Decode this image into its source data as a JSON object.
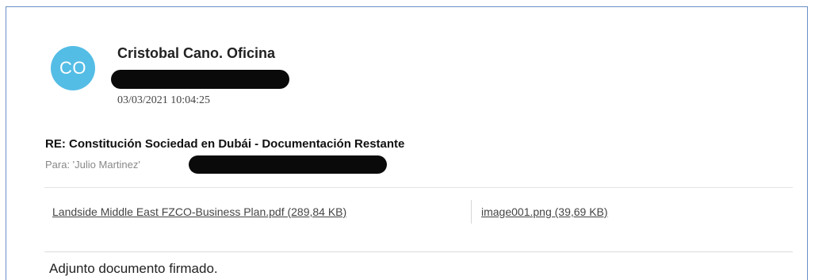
{
  "sender": {
    "avatar_initials": "CO",
    "avatar_color": "#54bde5",
    "name": "Cristobal Cano. Oficina",
    "timestamp": "03/03/2021 10:04:25"
  },
  "message": {
    "subject": "RE: Constitución Sociedad en Dubái - Documentación Restante",
    "recipient_line": "Para: 'Julio Martinez'",
    "body_first_line": "Adjunto documento firmado."
  },
  "attachments": [
    {
      "label": "Landside Middle East FZCO-Business Plan.pdf (289,84 KB)"
    },
    {
      "label": "image001.png (39,69 KB)"
    }
  ],
  "colors": {
    "frame_border": "#6a8fc7",
    "redaction": "#0a0a0a"
  }
}
